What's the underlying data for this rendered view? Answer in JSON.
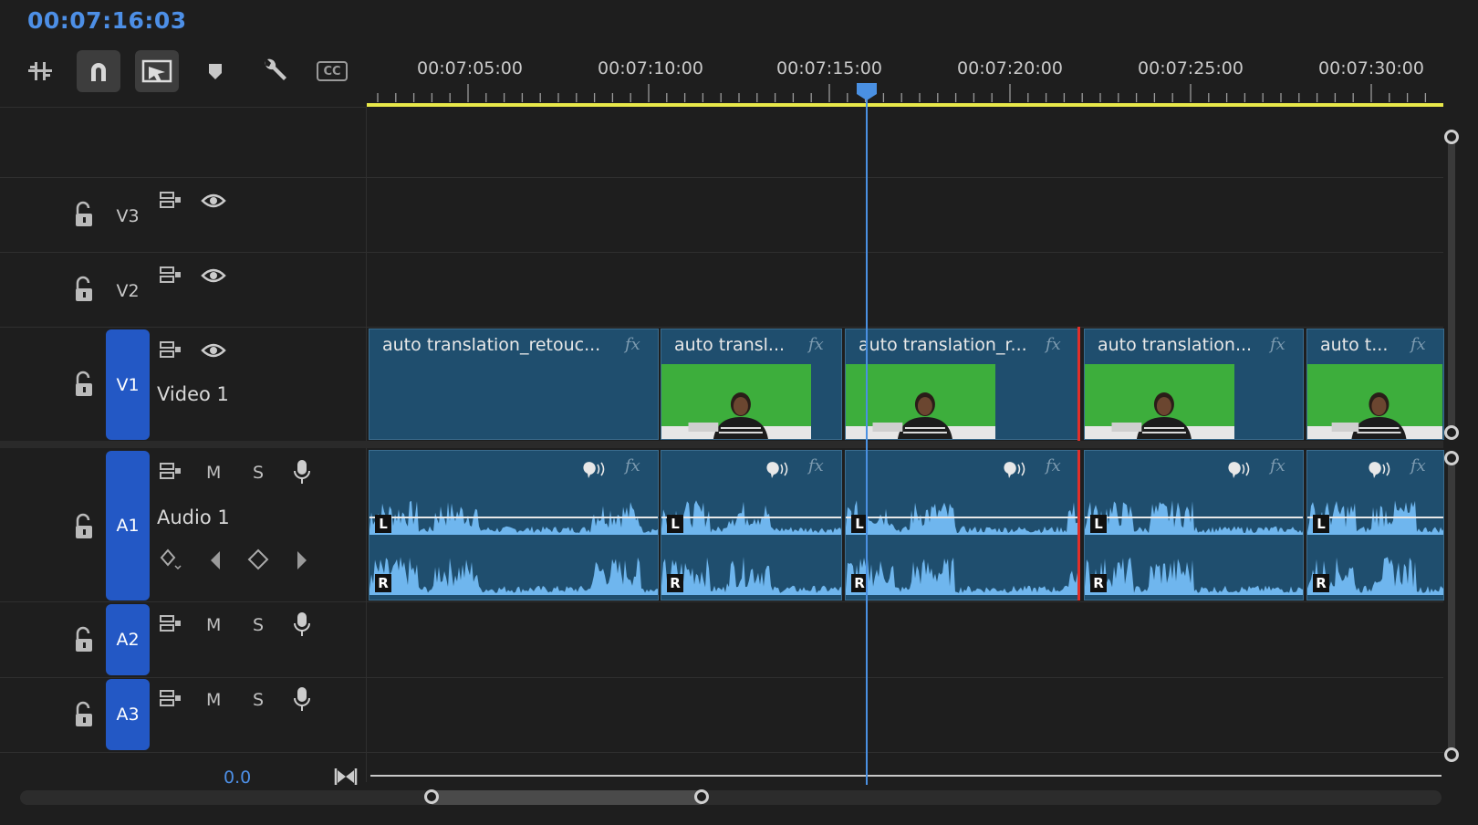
{
  "timecode": "00:07:16:03",
  "toolbar": {
    "tools": [
      "insert-overwrite-icon",
      "snap-magnet-icon",
      "linked-selection-icon",
      "add-marker-icon",
      "settings-wrench-icon",
      "captions-icon"
    ],
    "captions_label": "CC"
  },
  "ruler": {
    "labels": [
      "00:07:05:00",
      "00:07:10:00",
      "00:07:15:00",
      "00:07:20:00",
      "00:07:25:00",
      "00:07:30:00"
    ]
  },
  "tracks": {
    "v3": {
      "id": "V3"
    },
    "v2": {
      "id": "V2"
    },
    "v1": {
      "id": "V1",
      "name": "Video 1"
    },
    "a1": {
      "id": "A1",
      "name": "Audio 1",
      "m": "M",
      "s": "S"
    },
    "a2": {
      "id": "A2",
      "m": "M",
      "s": "S"
    },
    "a3": {
      "id": "A3",
      "m": "M",
      "s": "S"
    }
  },
  "master": {
    "volume": "0.0"
  },
  "clips": [
    {
      "label": "auto translation_retouc...",
      "fx": "fx"
    },
    {
      "label": "auto transl...",
      "fx": "fx"
    },
    {
      "label": "auto translation_r...",
      "fx": "fx"
    },
    {
      "label": "auto translation...",
      "fx": "fx"
    },
    {
      "label": "auto t...",
      "fx": "fx"
    }
  ],
  "audio_channels": {
    "left": "L",
    "right": "R"
  },
  "colors": {
    "accent": "#4d8fe6",
    "track_blue": "#2358c5",
    "clip": "#1f4e6e",
    "waveform": "#6fb6ee",
    "work_area": "#e8e84a",
    "edit_point": "#e0302a"
  }
}
